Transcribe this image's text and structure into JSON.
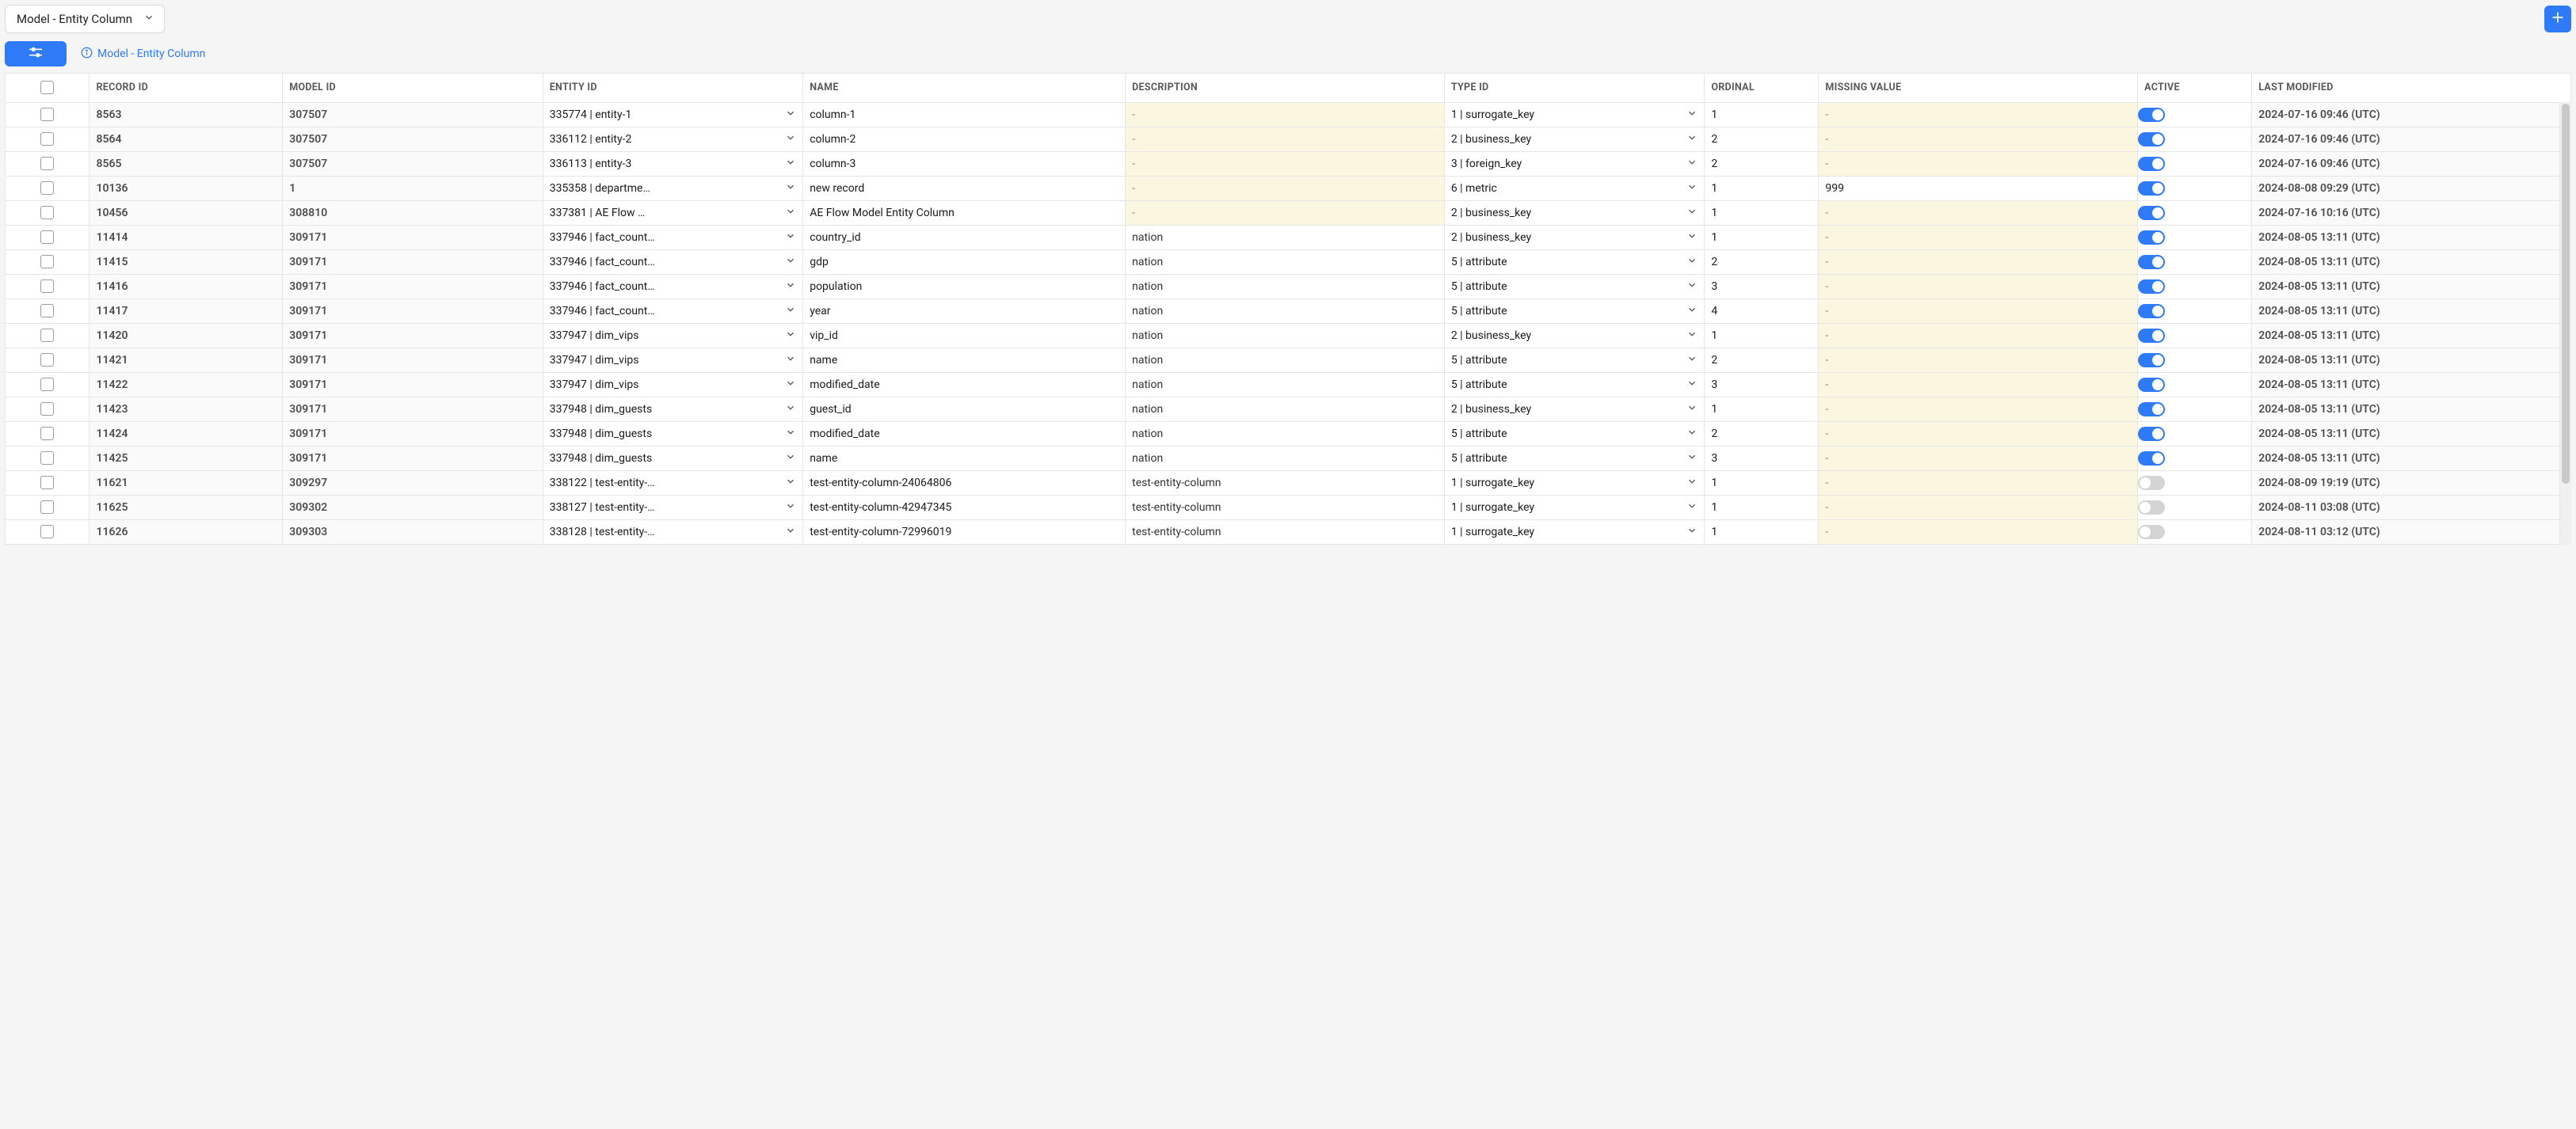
{
  "header": {
    "model_select_label": "Model - Entity Column",
    "info_label": "Model - Entity Column"
  },
  "columns": {
    "record_id": "RECORD ID",
    "model_id": "MODEL ID",
    "entity_id": "ENTITY ID",
    "name": "NAME",
    "description": "DESCRIPTION",
    "type_id": "TYPE ID",
    "ordinal": "ORDINAL",
    "missing_value": "MISSING VALUE",
    "active": "ACTIVE",
    "last_modified": "LAST MODIFIED"
  },
  "rows": [
    {
      "record_id": "8563",
      "model_id": "307507",
      "entity": "335774 | entity-1",
      "name": "column-1",
      "description": "-",
      "type": "1 | surrogate_key",
      "ordinal": "1",
      "missing": "-",
      "active": true,
      "last_modified": "2024-07-16 09:46 (UTC)"
    },
    {
      "record_id": "8564",
      "model_id": "307507",
      "entity": "336112 | entity-2",
      "name": "column-2",
      "description": "-",
      "type": "2 | business_key",
      "ordinal": "2",
      "missing": "-",
      "active": true,
      "last_modified": "2024-07-16 09:46 (UTC)"
    },
    {
      "record_id": "8565",
      "model_id": "307507",
      "entity": "336113 | entity-3",
      "name": "column-3",
      "description": "-",
      "type": "3 | foreign_key",
      "ordinal": "2",
      "missing": "-",
      "active": true,
      "last_modified": "2024-07-16 09:46 (UTC)"
    },
    {
      "record_id": "10136",
      "model_id": "1",
      "entity": "335358 | departme…",
      "name": "new record",
      "description": "-",
      "type": "6 | metric",
      "ordinal": "1",
      "missing": "999",
      "active": true,
      "last_modified": "2024-08-08 09:29 (UTC)"
    },
    {
      "record_id": "10456",
      "model_id": "308810",
      "entity": "337381 | AE Flow …",
      "name": "AE Flow Model Entity Column",
      "description": "-",
      "type": "2 | business_key",
      "ordinal": "1",
      "missing": "-",
      "active": true,
      "last_modified": "2024-07-16 10:16 (UTC)"
    },
    {
      "record_id": "11414",
      "model_id": "309171",
      "entity": "337946 | fact_count…",
      "name": "country_id",
      "description": "nation",
      "type": "2 | business_key",
      "ordinal": "1",
      "missing": "-",
      "active": true,
      "last_modified": "2024-08-05 13:11 (UTC)"
    },
    {
      "record_id": "11415",
      "model_id": "309171",
      "entity": "337946 | fact_count…",
      "name": "gdp",
      "description": "nation",
      "type": "5 | attribute",
      "ordinal": "2",
      "missing": "-",
      "active": true,
      "last_modified": "2024-08-05 13:11 (UTC)"
    },
    {
      "record_id": "11416",
      "model_id": "309171",
      "entity": "337946 | fact_count…",
      "name": "population",
      "description": "nation",
      "type": "5 | attribute",
      "ordinal": "3",
      "missing": "-",
      "active": true,
      "last_modified": "2024-08-05 13:11 (UTC)"
    },
    {
      "record_id": "11417",
      "model_id": "309171",
      "entity": "337946 | fact_count…",
      "name": "year",
      "description": "nation",
      "type": "5 | attribute",
      "ordinal": "4",
      "missing": "-",
      "active": true,
      "last_modified": "2024-08-05 13:11 (UTC)"
    },
    {
      "record_id": "11420",
      "model_id": "309171",
      "entity": "337947 | dim_vips",
      "name": "vip_id",
      "description": "nation",
      "type": "2 | business_key",
      "ordinal": "1",
      "missing": "-",
      "active": true,
      "last_modified": "2024-08-05 13:11 (UTC)"
    },
    {
      "record_id": "11421",
      "model_id": "309171",
      "entity": "337947 | dim_vips",
      "name": "name",
      "description": "nation",
      "type": "5 | attribute",
      "ordinal": "2",
      "missing": "-",
      "active": true,
      "last_modified": "2024-08-05 13:11 (UTC)"
    },
    {
      "record_id": "11422",
      "model_id": "309171",
      "entity": "337947 | dim_vips",
      "name": "modified_date",
      "description": "nation",
      "type": "5 | attribute",
      "ordinal": "3",
      "missing": "-",
      "active": true,
      "last_modified": "2024-08-05 13:11 (UTC)"
    },
    {
      "record_id": "11423",
      "model_id": "309171",
      "entity": "337948 | dim_guests",
      "name": "guest_id",
      "description": "nation",
      "type": "2 | business_key",
      "ordinal": "1",
      "missing": "-",
      "active": true,
      "last_modified": "2024-08-05 13:11 (UTC)"
    },
    {
      "record_id": "11424",
      "model_id": "309171",
      "entity": "337948 | dim_guests",
      "name": "modified_date",
      "description": "nation",
      "type": "5 | attribute",
      "ordinal": "2",
      "missing": "-",
      "active": true,
      "last_modified": "2024-08-05 13:11 (UTC)"
    },
    {
      "record_id": "11425",
      "model_id": "309171",
      "entity": "337948 | dim_guests",
      "name": "name",
      "description": "nation",
      "type": "5 | attribute",
      "ordinal": "3",
      "missing": "-",
      "active": true,
      "last_modified": "2024-08-05 13:11 (UTC)"
    },
    {
      "record_id": "11621",
      "model_id": "309297",
      "entity": "338122 | test-entity-…",
      "name": "test-entity-column-24064806",
      "description": "test-entity-column",
      "type": "1 | surrogate_key",
      "ordinal": "1",
      "missing": "-",
      "active": false,
      "last_modified": "2024-08-09 19:19 (UTC)"
    },
    {
      "record_id": "11625",
      "model_id": "309302",
      "entity": "338127 | test-entity-…",
      "name": "test-entity-column-42947345",
      "description": "test-entity-column",
      "type": "1 | surrogate_key",
      "ordinal": "1",
      "missing": "-",
      "active": false,
      "last_modified": "2024-08-11 03:08 (UTC)"
    },
    {
      "record_id": "11626",
      "model_id": "309303",
      "entity": "338128 | test-entity-…",
      "name": "test-entity-column-72996019",
      "description": "test-entity-column",
      "type": "1 | surrogate_key",
      "ordinal": "1",
      "missing": "-",
      "active": false,
      "last_modified": "2024-08-11 03:12 (UTC)"
    }
  ]
}
